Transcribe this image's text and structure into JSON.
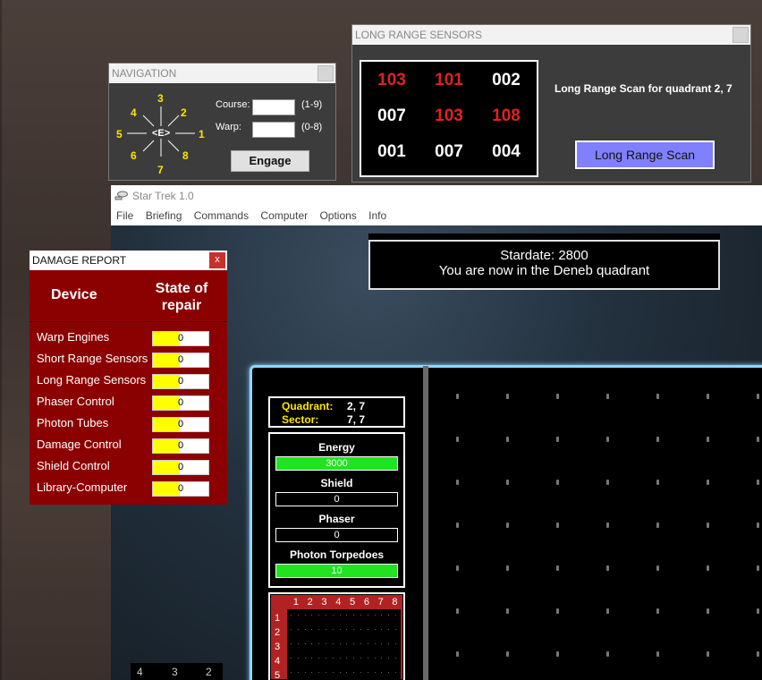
{
  "navigation": {
    "title": "NAVIGATION",
    "compass": {
      "n1": "1",
      "n2": "2",
      "n3": "3",
      "n4": "4",
      "n5": "5",
      "n6": "6",
      "n7": "7",
      "n8": "8",
      "center": "<E>"
    },
    "course_label": "Course:",
    "course_value": "",
    "course_range": "(1-9)",
    "warp_label": "Warp:",
    "warp_value": "",
    "warp_range": "(0-8)",
    "engage_label": "Engage"
  },
  "lrs": {
    "title": "LONG RANGE SENSORS",
    "grid": [
      {
        "value": "103",
        "color": "#e32020"
      },
      {
        "value": "101",
        "color": "#e32020"
      },
      {
        "value": "002",
        "color": "#ffffff"
      },
      {
        "value": "007",
        "color": "#ffffff"
      },
      {
        "value": "103",
        "color": "#e32020"
      },
      {
        "value": "108",
        "color": "#e32020"
      },
      {
        "value": "001",
        "color": "#ffffff"
      },
      {
        "value": "007",
        "color": "#ffffff"
      },
      {
        "value": "004",
        "color": "#ffffff"
      }
    ],
    "caption": "Long Range Scan for quadrant 2, 7",
    "button_label": "Long Range Scan"
  },
  "app": {
    "title": "Star Trek 1.0",
    "menu": [
      "File",
      "Briefing",
      "Commands",
      "Computer",
      "Options",
      "Info"
    ],
    "stardate": "Stardate: 2800",
    "message": "You are now in the Deneb quadrant",
    "quadrant_label": "Quadrant:",
    "quadrant_value": "2, 7",
    "sector_label": "Sector:",
    "sector_value": "7, 7",
    "status": {
      "energy_label": "Energy",
      "energy_value": "3000",
      "energy_fill": 1.0,
      "shield_label": "Shield",
      "shield_value": "0",
      "shield_fill": 0.0,
      "phaser_label": "Phaser",
      "phaser_value": "0",
      "phaser_fill": 0.0,
      "torpedo_label": "Photon Torpedoes",
      "torpedo_value": "10",
      "torpedo_fill": 1.0
    },
    "minimap": {
      "cols": [
        "1",
        "2",
        "3",
        "4",
        "5",
        "6",
        "7",
        "8"
      ],
      "rows": [
        "1",
        "2",
        "3",
        "4",
        "5"
      ]
    },
    "bottom_strip": [
      "4",
      "3",
      "2"
    ]
  },
  "damage": {
    "title": "DAMAGE REPORT",
    "close": "x",
    "col_device": "Device",
    "col_state": "State of repair",
    "rows": [
      {
        "device": "Warp Engines",
        "value": "0"
      },
      {
        "device": "Short Range Sensors",
        "value": "0"
      },
      {
        "device": "Long Range Sensors",
        "value": "0"
      },
      {
        "device": "Phaser Control",
        "value": "0"
      },
      {
        "device": "Photon Tubes",
        "value": "0"
      },
      {
        "device": "Damage Control",
        "value": "0"
      },
      {
        "device": "Shield Control",
        "value": "0"
      },
      {
        "device": "Library-Computer",
        "value": "0"
      }
    ]
  }
}
